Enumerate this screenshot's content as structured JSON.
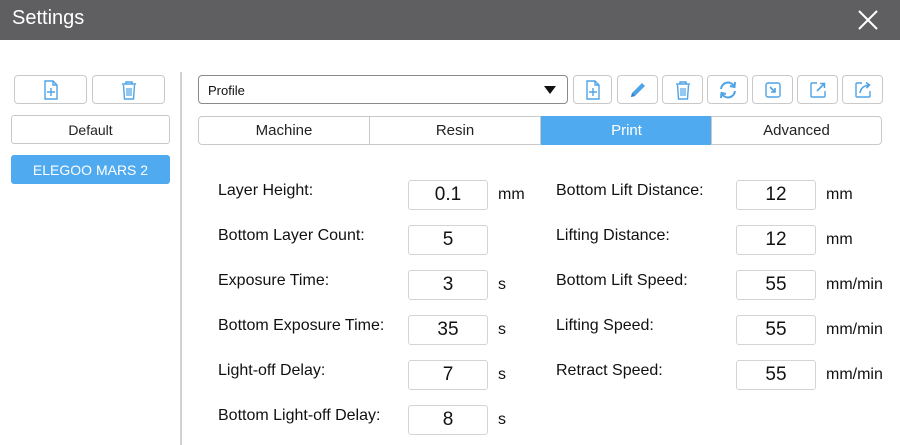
{
  "window": {
    "title": "Settings"
  },
  "icons": {
    "close": "close-icon",
    "new": "add-file-icon",
    "delete": "trash-icon",
    "edit": "pencil-icon",
    "refresh": "refresh-icon",
    "import": "import-icon",
    "export": "export-icon",
    "share": "share-icon",
    "dropdown": "chevron-down-icon"
  },
  "colors": {
    "titlebar": "#5f5f62",
    "accent": "#4faaf0",
    "icon": "#4ea3e6"
  },
  "sidebar": {
    "profiles": [
      {
        "label": "Default",
        "selected": false
      },
      {
        "label": "ELEGOO MARS 2",
        "selected": true
      }
    ]
  },
  "profile_select": {
    "value": "Profile"
  },
  "tabs": [
    {
      "label": "Machine",
      "active": false
    },
    {
      "label": "Resin",
      "active": false
    },
    {
      "label": "Print",
      "active": true
    },
    {
      "label": "Advanced",
      "active": false
    }
  ],
  "print_settings": {
    "left": [
      {
        "label": "Layer Height:",
        "value": "0.1",
        "unit": "mm"
      },
      {
        "label": "Bottom Layer Count:",
        "value": "5",
        "unit": ""
      },
      {
        "label": "Exposure Time:",
        "value": "3",
        "unit": "s"
      },
      {
        "label": "Bottom Exposure Time:",
        "value": "35",
        "unit": "s"
      },
      {
        "label": "Light-off Delay:",
        "value": "7",
        "unit": "s"
      },
      {
        "label": "Bottom Light-off Delay:",
        "value": "8",
        "unit": "s"
      }
    ],
    "right": [
      {
        "label": "Bottom Lift Distance:",
        "value": "12",
        "unit": "mm"
      },
      {
        "label": "Lifting Distance:",
        "value": "12",
        "unit": "mm"
      },
      {
        "label": "Bottom Lift Speed:",
        "value": "55",
        "unit": "mm/min"
      },
      {
        "label": "Lifting Speed:",
        "value": "55",
        "unit": "mm/min"
      },
      {
        "label": "Retract Speed:",
        "value": "55",
        "unit": "mm/min"
      }
    ]
  }
}
